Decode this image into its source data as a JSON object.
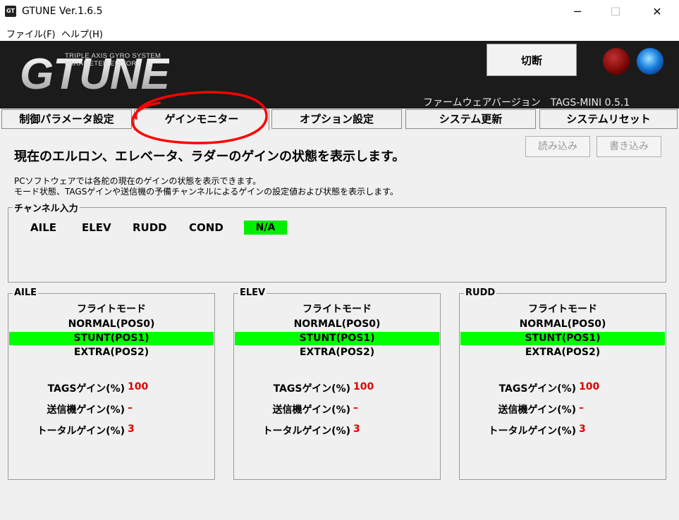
{
  "window": {
    "title": "GTUNE Ver.1.6.5",
    "icon_text": "GT",
    "controls": {
      "minimize": "─",
      "maximize": "☐",
      "close": "✕"
    }
  },
  "menu": [
    {
      "label": "ファイル(F)"
    },
    {
      "label": "ヘルプ(H)"
    }
  ],
  "header": {
    "logo_sub_line1": "TRIPLE AXIS GYRO SYSTEM",
    "logo_sub_line2": "PARAMETER EDITOR",
    "logo_text": "GTUNE",
    "disconnect_label": "切断",
    "firmware_label": "ファームウェアバージョン　TAGS-MINI 0.5.1",
    "led_colors": {
      "left": "#8b0000",
      "right": "#1a8fff"
    }
  },
  "tabs": [
    {
      "label": "制御パラメータ設定"
    },
    {
      "label": "ゲインモニター"
    },
    {
      "label": "オプション設定"
    },
    {
      "label": "システム更新"
    },
    {
      "label": "システムリセット"
    }
  ],
  "content": {
    "heading": "現在のエルロン、エレベータ、ラダーのゲインの状態を表示します。",
    "read_button": "読み込み",
    "write_button": "書き込み",
    "desc_line1": "PCソフトウェアでは各舵の現在のゲインの状態を表示できます。",
    "desc_line2": "モード状態、TAGSゲインや送信機の予備チャンネルによるゲインの設定値および状態を表示します。"
  },
  "channel_input": {
    "label": "チャンネル入力",
    "channels": [
      "AILE",
      "ELEV",
      "RUDD",
      "COND"
    ],
    "status": "N/A"
  },
  "panels": [
    {
      "label": "AILE",
      "flight_mode_label": "フライトモード",
      "modes": [
        "NORMAL(POS0)",
        "STUNT(POS1)",
        "EXTRA(POS2)"
      ],
      "tags_gain_label": "TAGSゲイン(%)",
      "tags_gain_value": "100",
      "tx_gain_label": "送信機ゲイン(%)",
      "tx_gain_value": "–",
      "total_gain_label": "トータルゲイン(%)",
      "total_gain_value": "3"
    },
    {
      "label": "ELEV",
      "flight_mode_label": "フライトモード",
      "modes": [
        "NORMAL(POS0)",
        "STUNT(POS1)",
        "EXTRA(POS2)"
      ],
      "tags_gain_label": "TAGSゲイン(%)",
      "tags_gain_value": "100",
      "tx_gain_label": "送信機ゲイン(%)",
      "tx_gain_value": "–",
      "total_gain_label": "トータルゲイン(%)",
      "total_gain_value": "3"
    },
    {
      "label": "RUDD",
      "flight_mode_label": "フライトモード",
      "modes": [
        "NORMAL(POS0)",
        "STUNT(POS1)",
        "EXTRA(POS2)"
      ],
      "tags_gain_label": "TAGSゲイン(%)",
      "tags_gain_value": "100",
      "tx_gain_label": "送信機ゲイン(%)",
      "tx_gain_value": "–",
      "total_gain_label": "トータルゲイン(%)",
      "total_gain_value": "3"
    }
  ],
  "colors": {
    "active_mode": "#00ff00",
    "gain_value": "#e00000",
    "annotation": "#ff0000"
  }
}
